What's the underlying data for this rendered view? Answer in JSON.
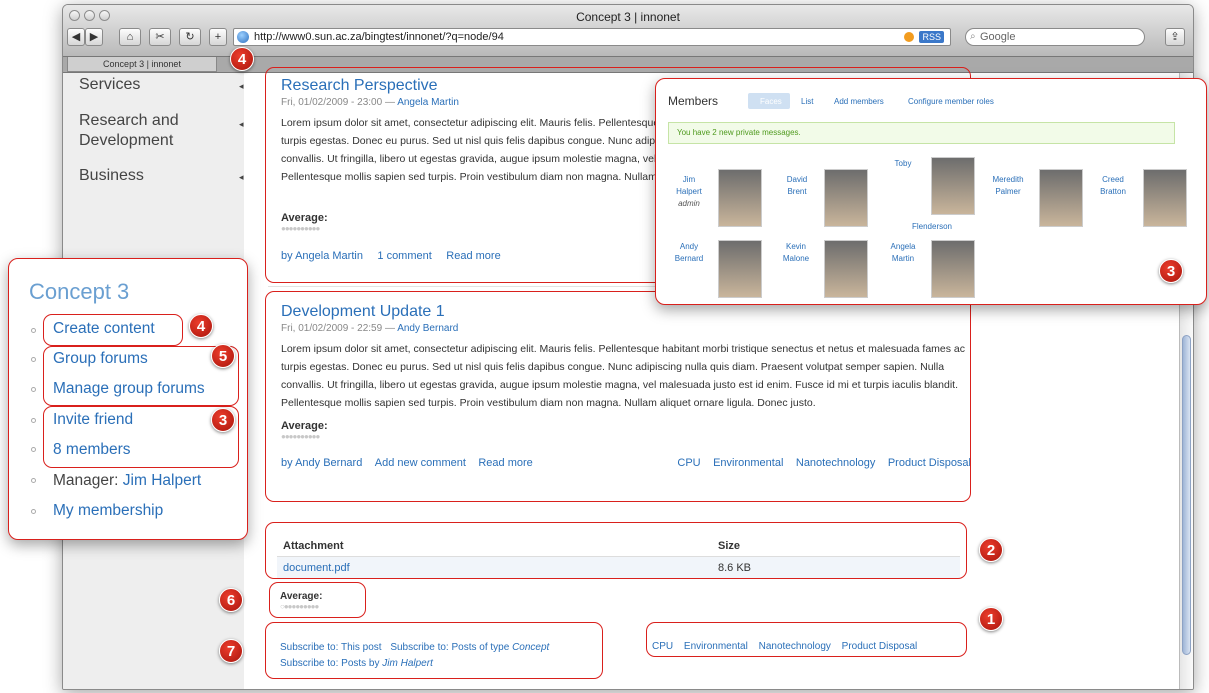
{
  "browser": {
    "window_title": "Concept 3 | innonet",
    "url": "http://www0.sun.ac.za/bingtest/innonet/?q=node/94",
    "rss_label": "RSS",
    "search_placeholder": "Google",
    "tab_label": "Concept 3 | innonet"
  },
  "sidebar": {
    "items": [
      {
        "label": "Services"
      },
      {
        "label": "Research and Development"
      },
      {
        "label": "Business"
      }
    ]
  },
  "posts": [
    {
      "title": "Research Perspective",
      "date": "Fri, 01/02/2009 - 23:00 — ",
      "author": "Angela Martin",
      "body": "Lorem ipsum dolor sit amet, consectetur adipiscing elit. Mauris felis. Pellentesque habitant morbi tristique senectus et netus et malesuada fames ac turpis egestas. Donec eu purus. Sed ut nisl quis felis dapibus congue. Nunc adipiscing nulla quis diam. Praesent volutpat semper sapien. Nulla convallis. Ut fringilla, libero ut egestas gravida, augue ipsum molestie magna, vel malesuada justo est id enim. Fusce id mi et turpis iaculis blandit. Pellentesque mollis sapien sed turpis. Proin vestibulum diam non magna. Nullam aliquet ornare ligula. Donec justo.",
      "average_label": "Average:",
      "links": [
        "by Angela Martin",
        "1 comment",
        "Read more"
      ]
    },
    {
      "title": "Development Update 1",
      "date": "Fri, 01/02/2009 - 22:59 — ",
      "author": "Andy Bernard",
      "body": "Lorem ipsum dolor sit amet, consectetur adipiscing elit. Mauris felis. Pellentesque habitant morbi tristique senectus et netus et malesuada fames ac turpis egestas. Donec eu purus. Sed ut nisl quis felis dapibus congue. Nunc adipiscing nulla quis diam. Praesent volutpat semper sapien. Nulla convallis. Ut fringilla, libero ut egestas gravida, augue ipsum molestie magna, vel malesuada justo est id enim. Fusce id mi et turpis iaculis blandit. Pellentesque mollis sapien sed turpis. Proin vestibulum diam non magna. Nullam aliquet ornare ligula. Donec justo.",
      "average_label": "Average:",
      "links": [
        "by Andy Bernard",
        "Add new comment",
        "Read more"
      ],
      "tags": [
        "CPU",
        "Environmental",
        "Nanotechnology",
        "Product Disposal"
      ]
    }
  ],
  "attachments": {
    "header_attachment": "Attachment",
    "header_size": "Size",
    "file": "document.pdf",
    "size": "8.6 KB"
  },
  "page_average_label": "Average:",
  "subscribe": {
    "line1a": "Subscribe to: This post",
    "line1b_prefix": "Subscribe to: Posts of type ",
    "line1b_em": "Concept",
    "line2_prefix": "Subscribe to: Posts by ",
    "line2_em": "Jim Halpert"
  },
  "terms": [
    "CPU",
    "Environmental",
    "Nanotechnology",
    "Product Disposal"
  ],
  "members_popup": {
    "title": "Members",
    "tabs": [
      "Faces",
      "List",
      "Add members",
      "Configure member roles"
    ],
    "message": "You have 2 new private messages.",
    "members": [
      {
        "first": "Jim",
        "last": "Halpert",
        "role": "admin"
      },
      {
        "first": "David",
        "last": "Brent"
      },
      {
        "first": "Toby",
        "last": "Flenderson"
      },
      {
        "first": "Meredith",
        "last": "Palmer"
      },
      {
        "first": "Creed",
        "last": "Bratton"
      },
      {
        "first": "Andy",
        "last": "Bernard"
      },
      {
        "first": "Kevin",
        "last": "Malone"
      },
      {
        "first": "Angela",
        "last": "Martin"
      }
    ]
  },
  "concept_box": {
    "title": "Concept 3",
    "items": [
      "Create content",
      "Group forums",
      "Manage group forums",
      "Invite friend",
      "8 members"
    ],
    "manager_prefix": "Manager: ",
    "manager_name": "Jim Halpert",
    "membership": "My membership"
  },
  "badges": [
    "4",
    "4",
    "5",
    "3",
    "3",
    "2",
    "6",
    "1",
    "7"
  ],
  "colors": {
    "annotation_red": "#d9201c",
    "link_blue": "#2a6fb8",
    "concept_title": "#6a9fd1"
  }
}
